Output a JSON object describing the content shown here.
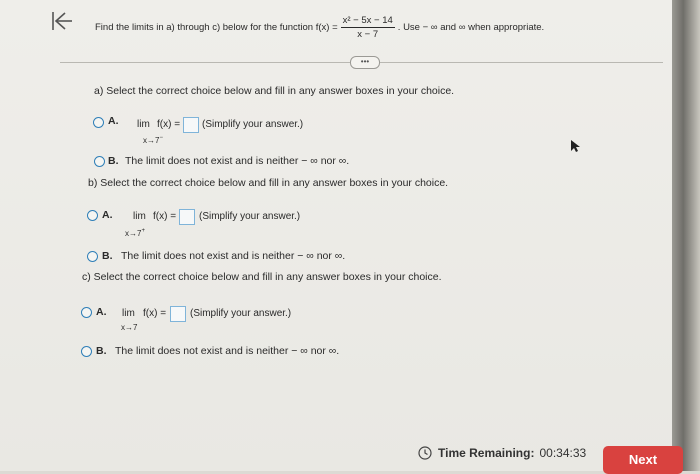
{
  "header": {
    "instruction_prefix": "Find the limits in a) through c) below for the function f(x) =",
    "numerator": "x² − 5x − 14",
    "denominator": "x − 7",
    "instruction_suffix": ". Use − ∞ and ∞ when appropriate."
  },
  "more_button": "•••",
  "parts": {
    "a": {
      "prompt": "a) Select the correct choice below and fill in any answer boxes in your choice.",
      "choice_a_letter": "A.",
      "lim": "lim",
      "fx": "f(x) =",
      "approach": "x→7",
      "approach_side": "−",
      "hint": "(Simplify your answer.)",
      "choice_b_letter": "B.",
      "choice_b_text": "The limit does not exist and is neither − ∞ nor ∞."
    },
    "b": {
      "prompt": "b) Select the correct choice below and fill in any answer boxes in your choice.",
      "choice_a_letter": "A.",
      "lim": "lim",
      "fx": "f(x) =",
      "approach": "x→7",
      "approach_side": "+",
      "hint": "(Simplify your answer.)",
      "choice_b_letter": "B.",
      "choice_b_text": "The limit does not exist and is neither − ∞ nor ∞."
    },
    "c": {
      "prompt": "c) Select the correct choice below and fill in any answer boxes in your choice.",
      "choice_a_letter": "A.",
      "lim": "lim",
      "fx": "f(x) =",
      "approach": "x→7",
      "hint": "(Simplify your answer.)",
      "choice_b_letter": "B.",
      "choice_b_text": "The limit does not exist and is neither − ∞ nor ∞."
    }
  },
  "timer": {
    "label": "Time Remaining:",
    "value": "00:34:33"
  },
  "next_button": "Next",
  "colors": {
    "accent": "#2f7fb8",
    "next": "#d9423f"
  }
}
